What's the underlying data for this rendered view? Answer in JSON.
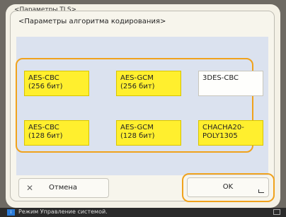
{
  "screen": {
    "outer_title": "<Параметры TLS>"
  },
  "dialog": {
    "title": "<Параметры алгоритма кодирования>"
  },
  "options": [
    {
      "label": "AES-CBC\n(256 бит)",
      "selected": true
    },
    {
      "label": "AES-GCM\n(256 бит)",
      "selected": true
    },
    {
      "label": "3DES-CBC",
      "selected": false
    },
    {
      "label": "AES-CBC\n(128 бит)",
      "selected": true
    },
    {
      "label": "AES-GCM\n(128 бит)",
      "selected": true
    },
    {
      "label": "CHACHA20-\nPOLY1305",
      "selected": true
    }
  ],
  "buttons": {
    "cancel": "Отмена",
    "ok": "OK"
  },
  "status_bar": {
    "text": "Режим Управление системой."
  },
  "icons": {
    "cancel": "close-icon",
    "ok": "enter-corner-icon",
    "status": "status-info-icon",
    "tray": "window-switch-icon"
  },
  "colors": {
    "accent": "#f0a21c",
    "selected": "#ffef2e",
    "background": "#f7f5ec",
    "panel": "#dbe2ef"
  }
}
